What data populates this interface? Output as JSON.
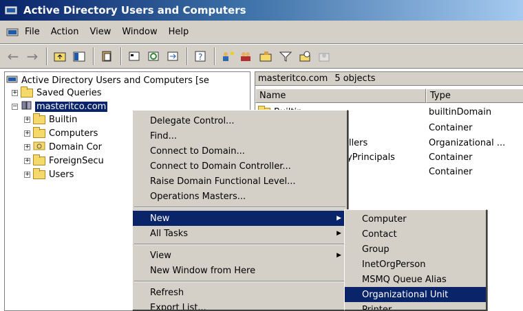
{
  "window": {
    "title": "Active Directory Users and Computers"
  },
  "menubar": {
    "items": [
      {
        "label": "File",
        "key": "F"
      },
      {
        "label": "Action",
        "key": "A"
      },
      {
        "label": "View",
        "key": "V"
      },
      {
        "label": "Window",
        "key": "W"
      },
      {
        "label": "Help",
        "key": "H"
      }
    ]
  },
  "tree": {
    "root_label": "Active Directory Users and Computers [se",
    "saved_queries": "Saved Queries",
    "domain": "masteritco.com",
    "children": [
      "Builtin",
      "Computers",
      "Domain Cor",
      "ForeignSecu",
      "Users"
    ]
  },
  "list": {
    "header_domain": "masteritco.com",
    "header_count": "5 objects",
    "col_name": "Name",
    "col_type": "Type",
    "rows": [
      {
        "name": "Builtin",
        "type": "builtinDomain"
      },
      {
        "name": "",
        "type": "Container"
      },
      {
        "name": "ollers",
        "type": "Organizational ..."
      },
      {
        "name": "tyPrincipals",
        "type": "Container"
      },
      {
        "name": "",
        "type": "Container"
      }
    ]
  },
  "context_menu": {
    "items": [
      "Delegate Control...",
      "Find...",
      "Connect to Domain...",
      "Connect to Domain Controller...",
      "Raise Domain Functional Level...",
      "Operations Masters...",
      "New",
      "All Tasks",
      "View",
      "New Window from Here",
      "Refresh",
      "Export List..."
    ]
  },
  "submenu": {
    "items": [
      "Computer",
      "Contact",
      "Group",
      "InetOrgPerson",
      "MSMQ Queue Alias",
      "Organizational Unit",
      "Printer"
    ],
    "highlighted": "Organizational Unit"
  },
  "colors": {
    "highlight": "#0a246a",
    "face": "#d4d0c8"
  }
}
